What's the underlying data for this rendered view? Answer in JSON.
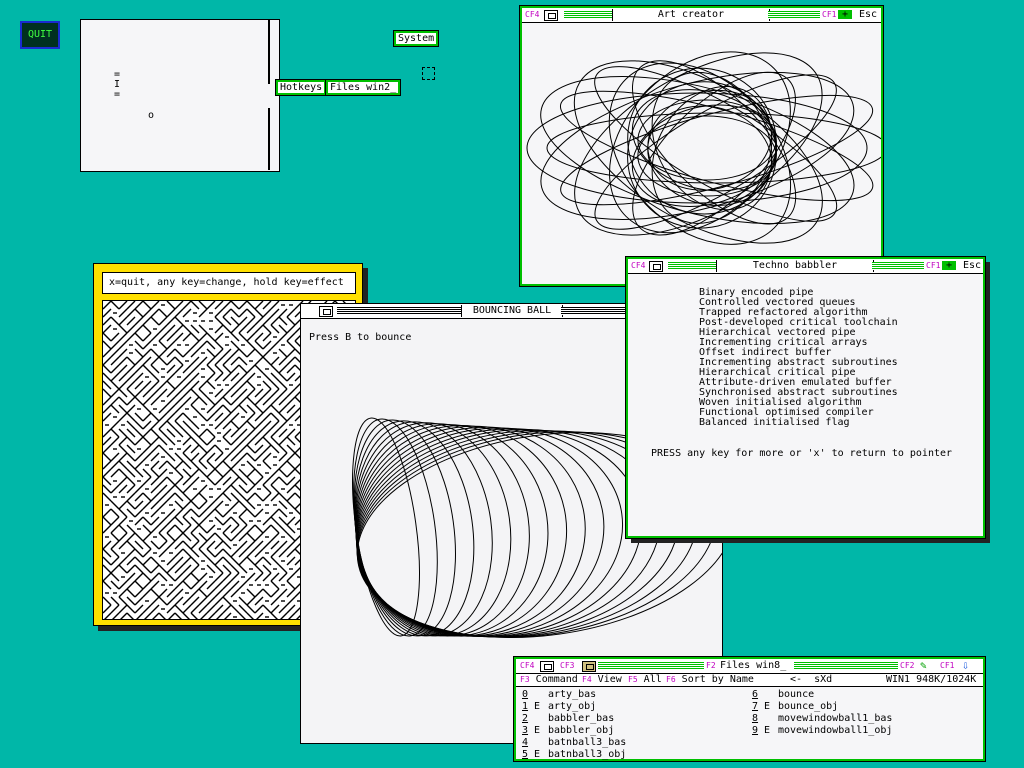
{
  "desktop": {
    "quit_label": "QUIT",
    "system_label": "System",
    "hotkeys_label": "Hotkeys",
    "files_label": "Files win2_"
  },
  "pong": {
    "paddle_chars": [
      "=",
      "I",
      "="
    ],
    "ball_char": "o"
  },
  "art_window": {
    "cf4": "CF4",
    "title": "Art creator",
    "cf1": "CF1",
    "esc": "Esc"
  },
  "maze_window": {
    "instructions": "x=quit, any key=change, hold key=effect"
  },
  "ball_window": {
    "title": "BOUNCING BALL",
    "prompt": "Press B to bounce"
  },
  "techno_window": {
    "cf4": "CF4",
    "title": "Techno babbler",
    "cf1": "CF1",
    "esc": "Esc",
    "lines": [
      "Binary encoded pipe",
      "Controlled vectored queues",
      "Trapped refactored algorithm",
      "Post-developed critical toolchain",
      "Hierarchical vectored pipe",
      "Incrementing critical arrays",
      "Offset indirect buffer",
      "Incrementing abstract subroutines",
      "Hierarchical critical pipe",
      "Attribute-driven emulated buffer",
      "Synchronised abstract subroutines",
      "Woven initialised algorithm",
      "Functional optimised compiler",
      "Balanced initialised flag"
    ],
    "footer": "PRESS any key for more or 'x' to return to pointer"
  },
  "files_window": {
    "cf4": "CF4",
    "cf3": "CF3",
    "f2": "F2",
    "title": "Files win8_",
    "cf2": "CF2",
    "cf1": "CF1",
    "menu": [
      {
        "key": "F3",
        "label": "Command"
      },
      {
        "key": "F4",
        "label": "View"
      },
      {
        "key": "F5",
        "label": "All"
      },
      {
        "key": "F6",
        "label": "Sort by Name"
      }
    ],
    "path": "<-  sXd",
    "status": "WIN1 948K/1024K",
    "files": [
      {
        "num": "0",
        "flag": "",
        "name": "arty_bas"
      },
      {
        "num": "1",
        "flag": "E",
        "name": "arty_obj"
      },
      {
        "num": "2",
        "flag": "",
        "name": "babbler_bas"
      },
      {
        "num": "3",
        "flag": "E",
        "name": "babbler_obj"
      },
      {
        "num": "4",
        "flag": "",
        "name": "batnball3_bas"
      },
      {
        "num": "5",
        "flag": "E",
        "name": "batnball3_obj"
      },
      {
        "num": "6",
        "flag": "",
        "name": "bounce"
      },
      {
        "num": "7",
        "flag": "E",
        "name": "bounce_obj"
      },
      {
        "num": "8",
        "flag": "",
        "name": "movewindowball1_bas"
      },
      {
        "num": "9",
        "flag": "E",
        "name": "movewindowball1_obj"
      }
    ]
  }
}
